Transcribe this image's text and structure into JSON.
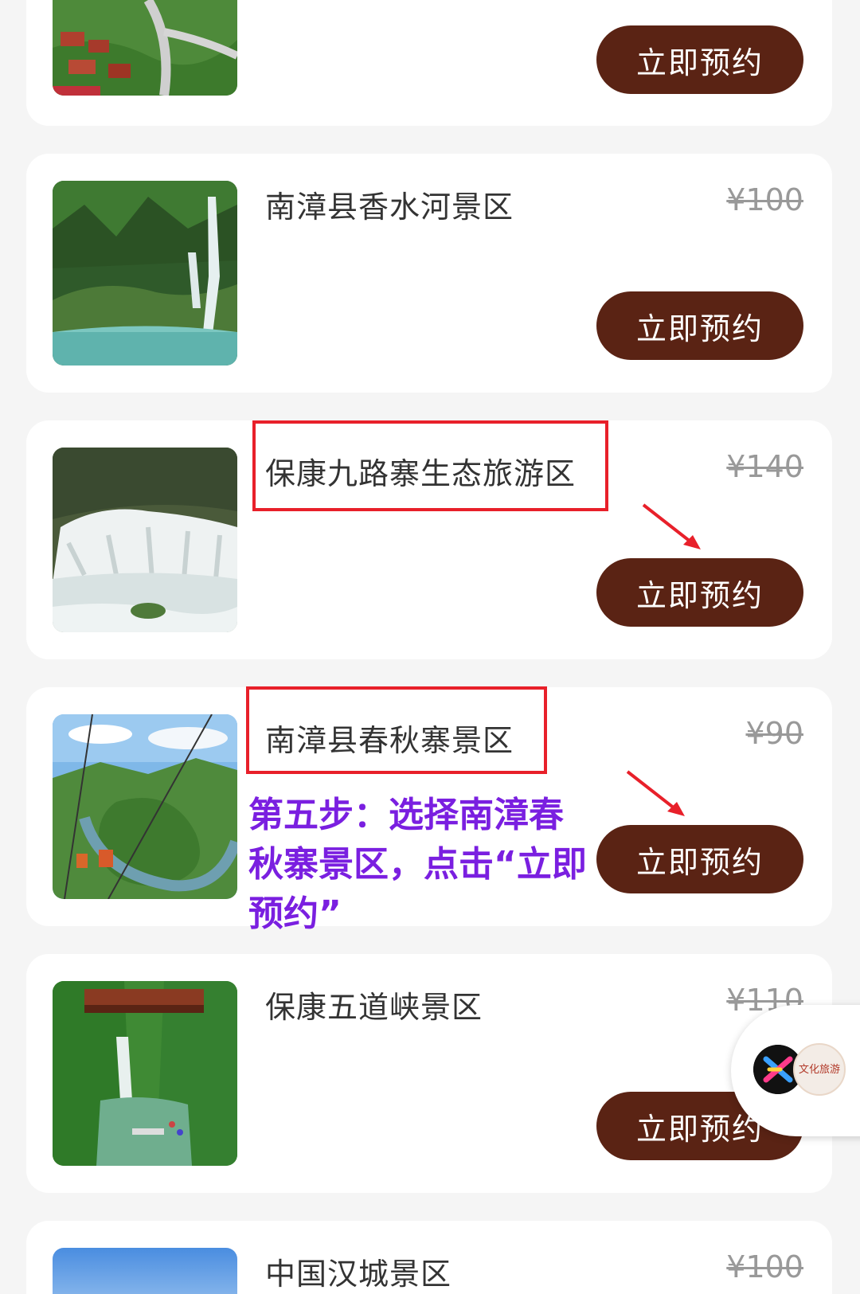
{
  "book_label": "立即预约",
  "items": [
    {
      "name": "",
      "price": ""
    },
    {
      "name": "南漳县香水河景区",
      "price": "¥100"
    },
    {
      "name": "保康九路寨生态旅游区",
      "price": "¥140"
    },
    {
      "name": "南漳县春秋寨景区",
      "price": "¥90"
    },
    {
      "name": "保康五道峡景区",
      "price": "¥110"
    },
    {
      "name": "中国汉城景区",
      "price": "¥100"
    }
  ],
  "instruction_text": "第五步：选择南漳春秋寨景区，点击“立即预约”",
  "float_widget": {
    "badge_text": "文化旅游"
  },
  "colors": {
    "button_bg": "#5a2314",
    "highlight": "#e8202a",
    "instruction": "#7a1fe0",
    "page_bg": "#f5f5f5"
  }
}
